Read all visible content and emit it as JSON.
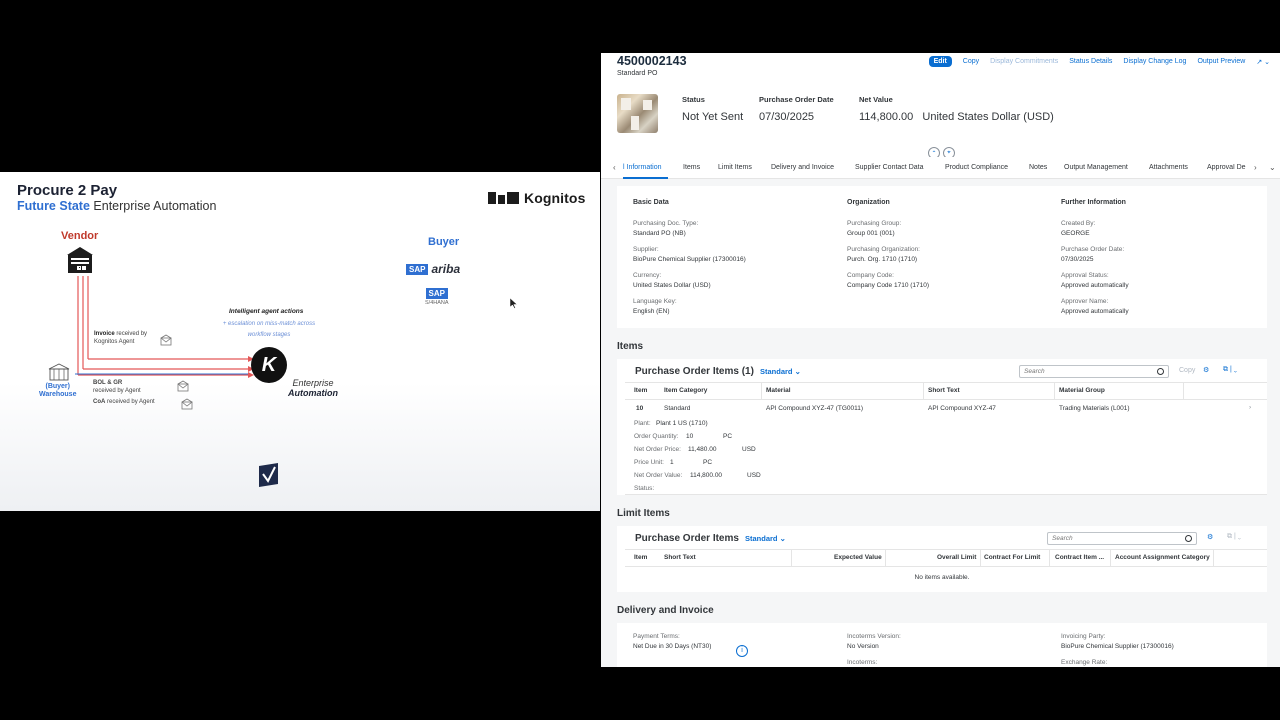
{
  "slide": {
    "title": "Procure 2 Pay",
    "subtitle_highlight": "Future State",
    "subtitle_rest": "Enterprise Automation",
    "brand": "Kognitos",
    "vendor_label": "Vendor",
    "buyer_label": "Buyer",
    "ariba_sap": "SAP",
    "ariba_word": "ariba",
    "s4_sap": "SAP",
    "s4_sub": "S/4HANA",
    "agent_title": "Intelligent agent actions",
    "agent_desc": "+ escalation on miss-match across workflow stages",
    "invoice_bold": "Invoice",
    "invoice_rest": "received by",
    "invoice_line2": "Kognitos Agent",
    "bol_bold": "BOL & GR",
    "bol_line2": "received by Agent",
    "coa_bold": "CoA",
    "coa_rest": "received by Agent",
    "buyer_wh_line1": "(Buyer)",
    "buyer_wh_line2": "Warehouse",
    "enterprise_line1": "Enterprise",
    "enterprise_line2": "Automation",
    "k_letter": "K"
  },
  "header": {
    "po_number": "4500002143",
    "po_type": "Standard PO",
    "actions": {
      "edit": "Edit",
      "copy": "Copy",
      "display_commitments": "Display Commitments",
      "status_details": "Status Details",
      "display_change_log": "Display Change Log",
      "output_preview": "Output Preview"
    },
    "kpis": [
      {
        "label": "Status",
        "value": "Not Yet Sent"
      },
      {
        "label": "Purchase Order Date",
        "value": "07/30/2025"
      },
      {
        "label": "Net Value",
        "value": "114,800.00   United States Dollar (USD)"
      }
    ]
  },
  "tabs": [
    "l Information",
    "Items",
    "Limit Items",
    "Delivery and Invoice",
    "Supplier Contact Data",
    "Product Compliance",
    "Notes",
    "Output Management",
    "Attachments",
    "Approval De"
  ],
  "general": {
    "groups": {
      "basic": "Basic Data",
      "organization": "Organization",
      "further": "Further Information"
    },
    "basic": [
      {
        "label": "Purchasing Doc. Type:",
        "value": "Standard PO (NB)"
      },
      {
        "label": "Supplier:",
        "value": "BioPure Chemical Supplier (17300016)"
      },
      {
        "label": "Currency:",
        "value": "United States Dollar (USD)"
      },
      {
        "label": "Language Key:",
        "value": "English (EN)"
      }
    ],
    "organization": [
      {
        "label": "Purchasing Group:",
        "value": "Group 001 (001)"
      },
      {
        "label": "Purchasing Organization:",
        "value": "Purch. Org. 1710 (1710)"
      },
      {
        "label": "Company Code:",
        "value": "Company Code 1710 (1710)"
      }
    ],
    "further": [
      {
        "label": "Created By:",
        "value": "GEORGE"
      },
      {
        "label": "Purchase Order Date:",
        "value": "07/30/2025"
      },
      {
        "label": "Approval Status:",
        "value": "Approved automatically"
      },
      {
        "label": "Approver Name:",
        "value": "Approved automatically"
      }
    ]
  },
  "items": {
    "section_title": "Items",
    "table_title": "Purchase Order Items (1)",
    "variant": "Standard",
    "search_placeholder": "Search",
    "copy": "Copy",
    "columns": [
      "Item",
      "Item Category",
      "Material",
      "Short Text",
      "Material Group"
    ],
    "row": {
      "item": "10",
      "category": "Standard",
      "material": "API Compound XYZ-47 (TG0011)",
      "short_text": "API Compound XYZ-47",
      "material_group": "Trading Materials (L001)"
    },
    "details": [
      {
        "label": "Plant:",
        "value": "Plant 1 US (1710)",
        "unit": ""
      },
      {
        "label": "Order Quantity:",
        "value": "10",
        "unit": "PC"
      },
      {
        "label": "Net Order Price:",
        "value": "11,480.00",
        "unit": "USD"
      },
      {
        "label": "Price Unit:",
        "value": "1",
        "unit": "PC"
      },
      {
        "label": "Net Order Value:",
        "value": "114,800.00",
        "unit": "USD"
      },
      {
        "label": "Status:",
        "value": "",
        "unit": ""
      }
    ]
  },
  "limit_items": {
    "section_title": "Limit Items",
    "table_title": "Purchase Order Items",
    "variant": "Standard",
    "search_placeholder": "Search",
    "columns": [
      "Item",
      "Short Text",
      "Expected Value",
      "Overall Limit",
      "Contract For Limit",
      "Contract Item ...",
      "Account Assignment Category"
    ],
    "empty": "No items available."
  },
  "delivery": {
    "section_title": "Delivery and Invoice",
    "fields": [
      {
        "label": "Payment Terms:",
        "value": "Net Due in 30 Days (NT30)"
      },
      {
        "label": "Incoterms Version:",
        "value": "No Version"
      },
      {
        "label": "Incoterms:",
        "value": ""
      },
      {
        "label": "Invoicing Party:",
        "value": "BioPure Chemical Supplier (17300016)"
      },
      {
        "label": "Exchange Rate:",
        "value": ""
      }
    ]
  },
  "colors": {
    "accent": "#0a6ed1",
    "vendor": "#c0392b",
    "buyer": "#2f6fd1"
  }
}
